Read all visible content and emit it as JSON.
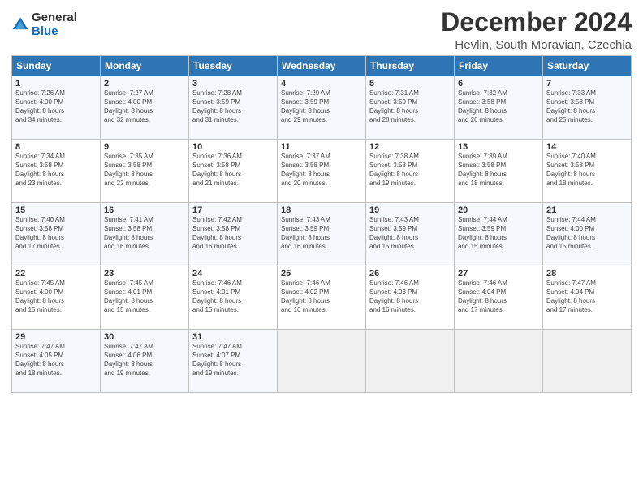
{
  "header": {
    "logo_general": "General",
    "logo_blue": "Blue",
    "month_title": "December 2024",
    "location": "Hevlin, South Moravian, Czechia"
  },
  "weekdays": [
    "Sunday",
    "Monday",
    "Tuesday",
    "Wednesday",
    "Thursday",
    "Friday",
    "Saturday"
  ],
  "weeks": [
    [
      {
        "day": "1",
        "info": "Sunrise: 7:26 AM\nSunset: 4:00 PM\nDaylight: 8 hours\nand 34 minutes."
      },
      {
        "day": "2",
        "info": "Sunrise: 7:27 AM\nSunset: 4:00 PM\nDaylight: 8 hours\nand 32 minutes."
      },
      {
        "day": "3",
        "info": "Sunrise: 7:28 AM\nSunset: 3:59 PM\nDaylight: 8 hours\nand 31 minutes."
      },
      {
        "day": "4",
        "info": "Sunrise: 7:29 AM\nSunset: 3:59 PM\nDaylight: 8 hours\nand 29 minutes."
      },
      {
        "day": "5",
        "info": "Sunrise: 7:31 AM\nSunset: 3:59 PM\nDaylight: 8 hours\nand 28 minutes."
      },
      {
        "day": "6",
        "info": "Sunrise: 7:32 AM\nSunset: 3:58 PM\nDaylight: 8 hours\nand 26 minutes."
      },
      {
        "day": "7",
        "info": "Sunrise: 7:33 AM\nSunset: 3:58 PM\nDaylight: 8 hours\nand 25 minutes."
      }
    ],
    [
      {
        "day": "8",
        "info": "Sunrise: 7:34 AM\nSunset: 3:58 PM\nDaylight: 8 hours\nand 23 minutes."
      },
      {
        "day": "9",
        "info": "Sunrise: 7:35 AM\nSunset: 3:58 PM\nDaylight: 8 hours\nand 22 minutes."
      },
      {
        "day": "10",
        "info": "Sunrise: 7:36 AM\nSunset: 3:58 PM\nDaylight: 8 hours\nand 21 minutes."
      },
      {
        "day": "11",
        "info": "Sunrise: 7:37 AM\nSunset: 3:58 PM\nDaylight: 8 hours\nand 20 minutes."
      },
      {
        "day": "12",
        "info": "Sunrise: 7:38 AM\nSunset: 3:58 PM\nDaylight: 8 hours\nand 19 minutes."
      },
      {
        "day": "13",
        "info": "Sunrise: 7:39 AM\nSunset: 3:58 PM\nDaylight: 8 hours\nand 18 minutes."
      },
      {
        "day": "14",
        "info": "Sunrise: 7:40 AM\nSunset: 3:58 PM\nDaylight: 8 hours\nand 18 minutes."
      }
    ],
    [
      {
        "day": "15",
        "info": "Sunrise: 7:40 AM\nSunset: 3:58 PM\nDaylight: 8 hours\nand 17 minutes."
      },
      {
        "day": "16",
        "info": "Sunrise: 7:41 AM\nSunset: 3:58 PM\nDaylight: 8 hours\nand 16 minutes."
      },
      {
        "day": "17",
        "info": "Sunrise: 7:42 AM\nSunset: 3:58 PM\nDaylight: 8 hours\nand 16 minutes."
      },
      {
        "day": "18",
        "info": "Sunrise: 7:43 AM\nSunset: 3:59 PM\nDaylight: 8 hours\nand 16 minutes."
      },
      {
        "day": "19",
        "info": "Sunrise: 7:43 AM\nSunset: 3:59 PM\nDaylight: 8 hours\nand 15 minutes."
      },
      {
        "day": "20",
        "info": "Sunrise: 7:44 AM\nSunset: 3:59 PM\nDaylight: 8 hours\nand 15 minutes."
      },
      {
        "day": "21",
        "info": "Sunrise: 7:44 AM\nSunset: 4:00 PM\nDaylight: 8 hours\nand 15 minutes."
      }
    ],
    [
      {
        "day": "22",
        "info": "Sunrise: 7:45 AM\nSunset: 4:00 PM\nDaylight: 8 hours\nand 15 minutes."
      },
      {
        "day": "23",
        "info": "Sunrise: 7:45 AM\nSunset: 4:01 PM\nDaylight: 8 hours\nand 15 minutes."
      },
      {
        "day": "24",
        "info": "Sunrise: 7:46 AM\nSunset: 4:01 PM\nDaylight: 8 hours\nand 15 minutes."
      },
      {
        "day": "25",
        "info": "Sunrise: 7:46 AM\nSunset: 4:02 PM\nDaylight: 8 hours\nand 16 minutes."
      },
      {
        "day": "26",
        "info": "Sunrise: 7:46 AM\nSunset: 4:03 PM\nDaylight: 8 hours\nand 16 minutes."
      },
      {
        "day": "27",
        "info": "Sunrise: 7:46 AM\nSunset: 4:04 PM\nDaylight: 8 hours\nand 17 minutes."
      },
      {
        "day": "28",
        "info": "Sunrise: 7:47 AM\nSunset: 4:04 PM\nDaylight: 8 hours\nand 17 minutes."
      }
    ],
    [
      {
        "day": "29",
        "info": "Sunrise: 7:47 AM\nSunset: 4:05 PM\nDaylight: 8 hours\nand 18 minutes."
      },
      {
        "day": "30",
        "info": "Sunrise: 7:47 AM\nSunset: 4:06 PM\nDaylight: 8 hours\nand 19 minutes."
      },
      {
        "day": "31",
        "info": "Sunrise: 7:47 AM\nSunset: 4:07 PM\nDaylight: 8 hours\nand 19 minutes."
      },
      {
        "day": "",
        "info": ""
      },
      {
        "day": "",
        "info": ""
      },
      {
        "day": "",
        "info": ""
      },
      {
        "day": "",
        "info": ""
      }
    ]
  ]
}
